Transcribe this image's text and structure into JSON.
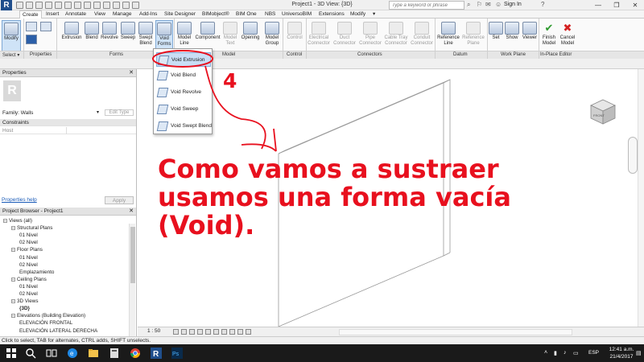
{
  "app": {
    "logo_letter": "R",
    "window_title": "Project1 - 3D View: {3D}",
    "search_placeholder": "Type a keyword or phrase",
    "sign_in": "Sign In",
    "win_controls": [
      "—",
      "❐",
      "✕"
    ]
  },
  "tabs": [
    "Create",
    "Insert",
    "Annotate",
    "View",
    "Manage",
    "Add-Ins",
    "Site Designer",
    "BIMobject®",
    "BIM One",
    "NBS",
    "UniversoBIM",
    "Extensions",
    "Modify"
  ],
  "ribbon": {
    "buttons": [
      {
        "label": "Modify",
        "enabled": true
      },
      {
        "label": "Extrusion",
        "enabled": true
      },
      {
        "label": "Blend",
        "enabled": true
      },
      {
        "label": "Revolve",
        "enabled": true
      },
      {
        "label": "Sweep",
        "enabled": true
      },
      {
        "label": "Swept Blend",
        "enabled": true
      },
      {
        "label": "Void Forms",
        "enabled": true
      },
      {
        "label": "Model Line",
        "enabled": true
      },
      {
        "label": "Component",
        "enabled": true
      },
      {
        "label": "Model Text",
        "enabled": false
      },
      {
        "label": "Opening",
        "enabled": true
      },
      {
        "label": "Model Group",
        "enabled": true
      },
      {
        "label": "Control",
        "enabled": false
      },
      {
        "label": "Electrical Connector",
        "enabled": false
      },
      {
        "label": "Duct Connector",
        "enabled": false
      },
      {
        "label": "Pipe Connector",
        "enabled": false
      },
      {
        "label": "Cable Tray Connector",
        "enabled": false
      },
      {
        "label": "Conduit Connector",
        "enabled": false
      },
      {
        "label": "Reference Line",
        "enabled": true
      },
      {
        "label": "Reference Plane",
        "enabled": false
      },
      {
        "label": "Set",
        "enabled": true
      },
      {
        "label": "Show",
        "enabled": true
      },
      {
        "label": "Viewer",
        "enabled": true
      },
      {
        "label": "Finish Model",
        "enabled": true
      },
      {
        "label": "Cancel Model",
        "enabled": true
      }
    ],
    "panels": [
      "Select ▾",
      "Properties",
      "Forms",
      "Model",
      "Control",
      "Connectors",
      "Datum",
      "Work Plane",
      "In-Place Editor"
    ]
  },
  "void_menu": {
    "items": [
      "Void Extrusion",
      "Void Blend",
      "Void Revolve",
      "Void Sweep",
      "Void Swept Blend"
    ],
    "highlighted": "Void Extrusion"
  },
  "properties": {
    "title": "Properties",
    "preview_letter": "R",
    "family_label": "Family: Walls",
    "edit_type": "Edit Type",
    "section": "Constraints",
    "row_host": "Host",
    "help_link": "Properties help",
    "apply": "Apply"
  },
  "browser": {
    "title": "Project Browser - Project1",
    "tree": [
      {
        "label": "Views (all)",
        "level": 0,
        "exp": "−"
      },
      {
        "label": "Structural Plans",
        "level": 1,
        "exp": "−"
      },
      {
        "label": "01 Nivel",
        "level": 2
      },
      {
        "label": "02 Nivel",
        "level": 2
      },
      {
        "label": "Floor Plans",
        "level": 1,
        "exp": "−"
      },
      {
        "label": "01 Nivel",
        "level": 2
      },
      {
        "label": "02 Nivel",
        "level": 2
      },
      {
        "label": "Emplazamiento",
        "level": 2
      },
      {
        "label": "Ceiling Plans",
        "level": 1,
        "exp": "−"
      },
      {
        "label": "01 Nivel",
        "level": 2
      },
      {
        "label": "02 Nivel",
        "level": 2
      },
      {
        "label": "3D Views",
        "level": 1,
        "exp": "−"
      },
      {
        "label": "{3D}",
        "level": 2,
        "bold": true
      },
      {
        "label": "Elevations (Building Elevation)",
        "level": 1,
        "exp": "−"
      },
      {
        "label": "ELEVACIÓN FRONTAL",
        "level": 2
      },
      {
        "label": "ELEVACIÓN LATERAL DERECHA",
        "level": 2
      }
    ]
  },
  "viewbar": {
    "scale": "1 : 50"
  },
  "status": {
    "text": "Click to select, TAB for alternates, CTRL adds, SHIFT unselects."
  },
  "taskbar": {
    "lang": "ESP",
    "time": "12:41 a.m.",
    "date": "21/4/2017"
  },
  "annotation": {
    "step_number": "4",
    "message": "Como vamos a sustraer usamos una forma vacía (Void).",
    "color": "#e8101e"
  },
  "colors": {
    "accent": "#1f4e8c",
    "highlight": "#c9def5",
    "annotation": "#e8101e"
  }
}
